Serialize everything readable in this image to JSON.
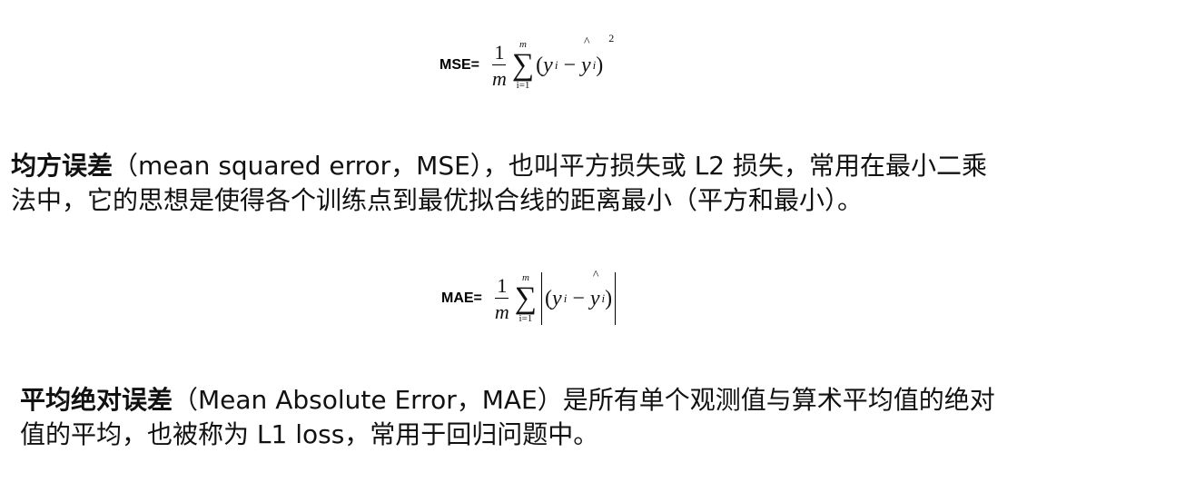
{
  "mse_formula": {
    "label": "MSE=",
    "numerator": "1",
    "denominator": "m",
    "sum_upper": "m",
    "sum_symbol": "∑",
    "sum_lower": "i=1",
    "open": "(",
    "y": "y",
    "sub_i": "i",
    "minus": "−",
    "hat": "^",
    "y_hat": "y",
    "sub_i2": "i",
    "close": ")",
    "power": "2"
  },
  "mse_paragraph": {
    "term": "均方误差",
    "line1": "（mean squared error，MSE），也叫平方损失或 L2 损失，常用在最小二乘",
    "line2": "法中，它的思想是使得各个训练点到最优拟合线的距离最小（平方和最小）。"
  },
  "mae_formula": {
    "label": "MAE=",
    "numerator": "1",
    "denominator": "m",
    "sum_upper": "m",
    "sum_symbol": "∑",
    "sum_lower": "i=1",
    "open": "(",
    "y": "y",
    "sub_i": "i",
    "minus": "−",
    "hat": "^",
    "y_hat": "y",
    "sub_i2": "i",
    "close": ")"
  },
  "mae_paragraph": {
    "term": "平均绝对误差",
    "line1": "（Mean Absolute Error，MAE）是所有单个观测值与算术平均值的绝对",
    "line2": "值的平均，也被称为 L1 loss，常用于回归问题中。"
  }
}
